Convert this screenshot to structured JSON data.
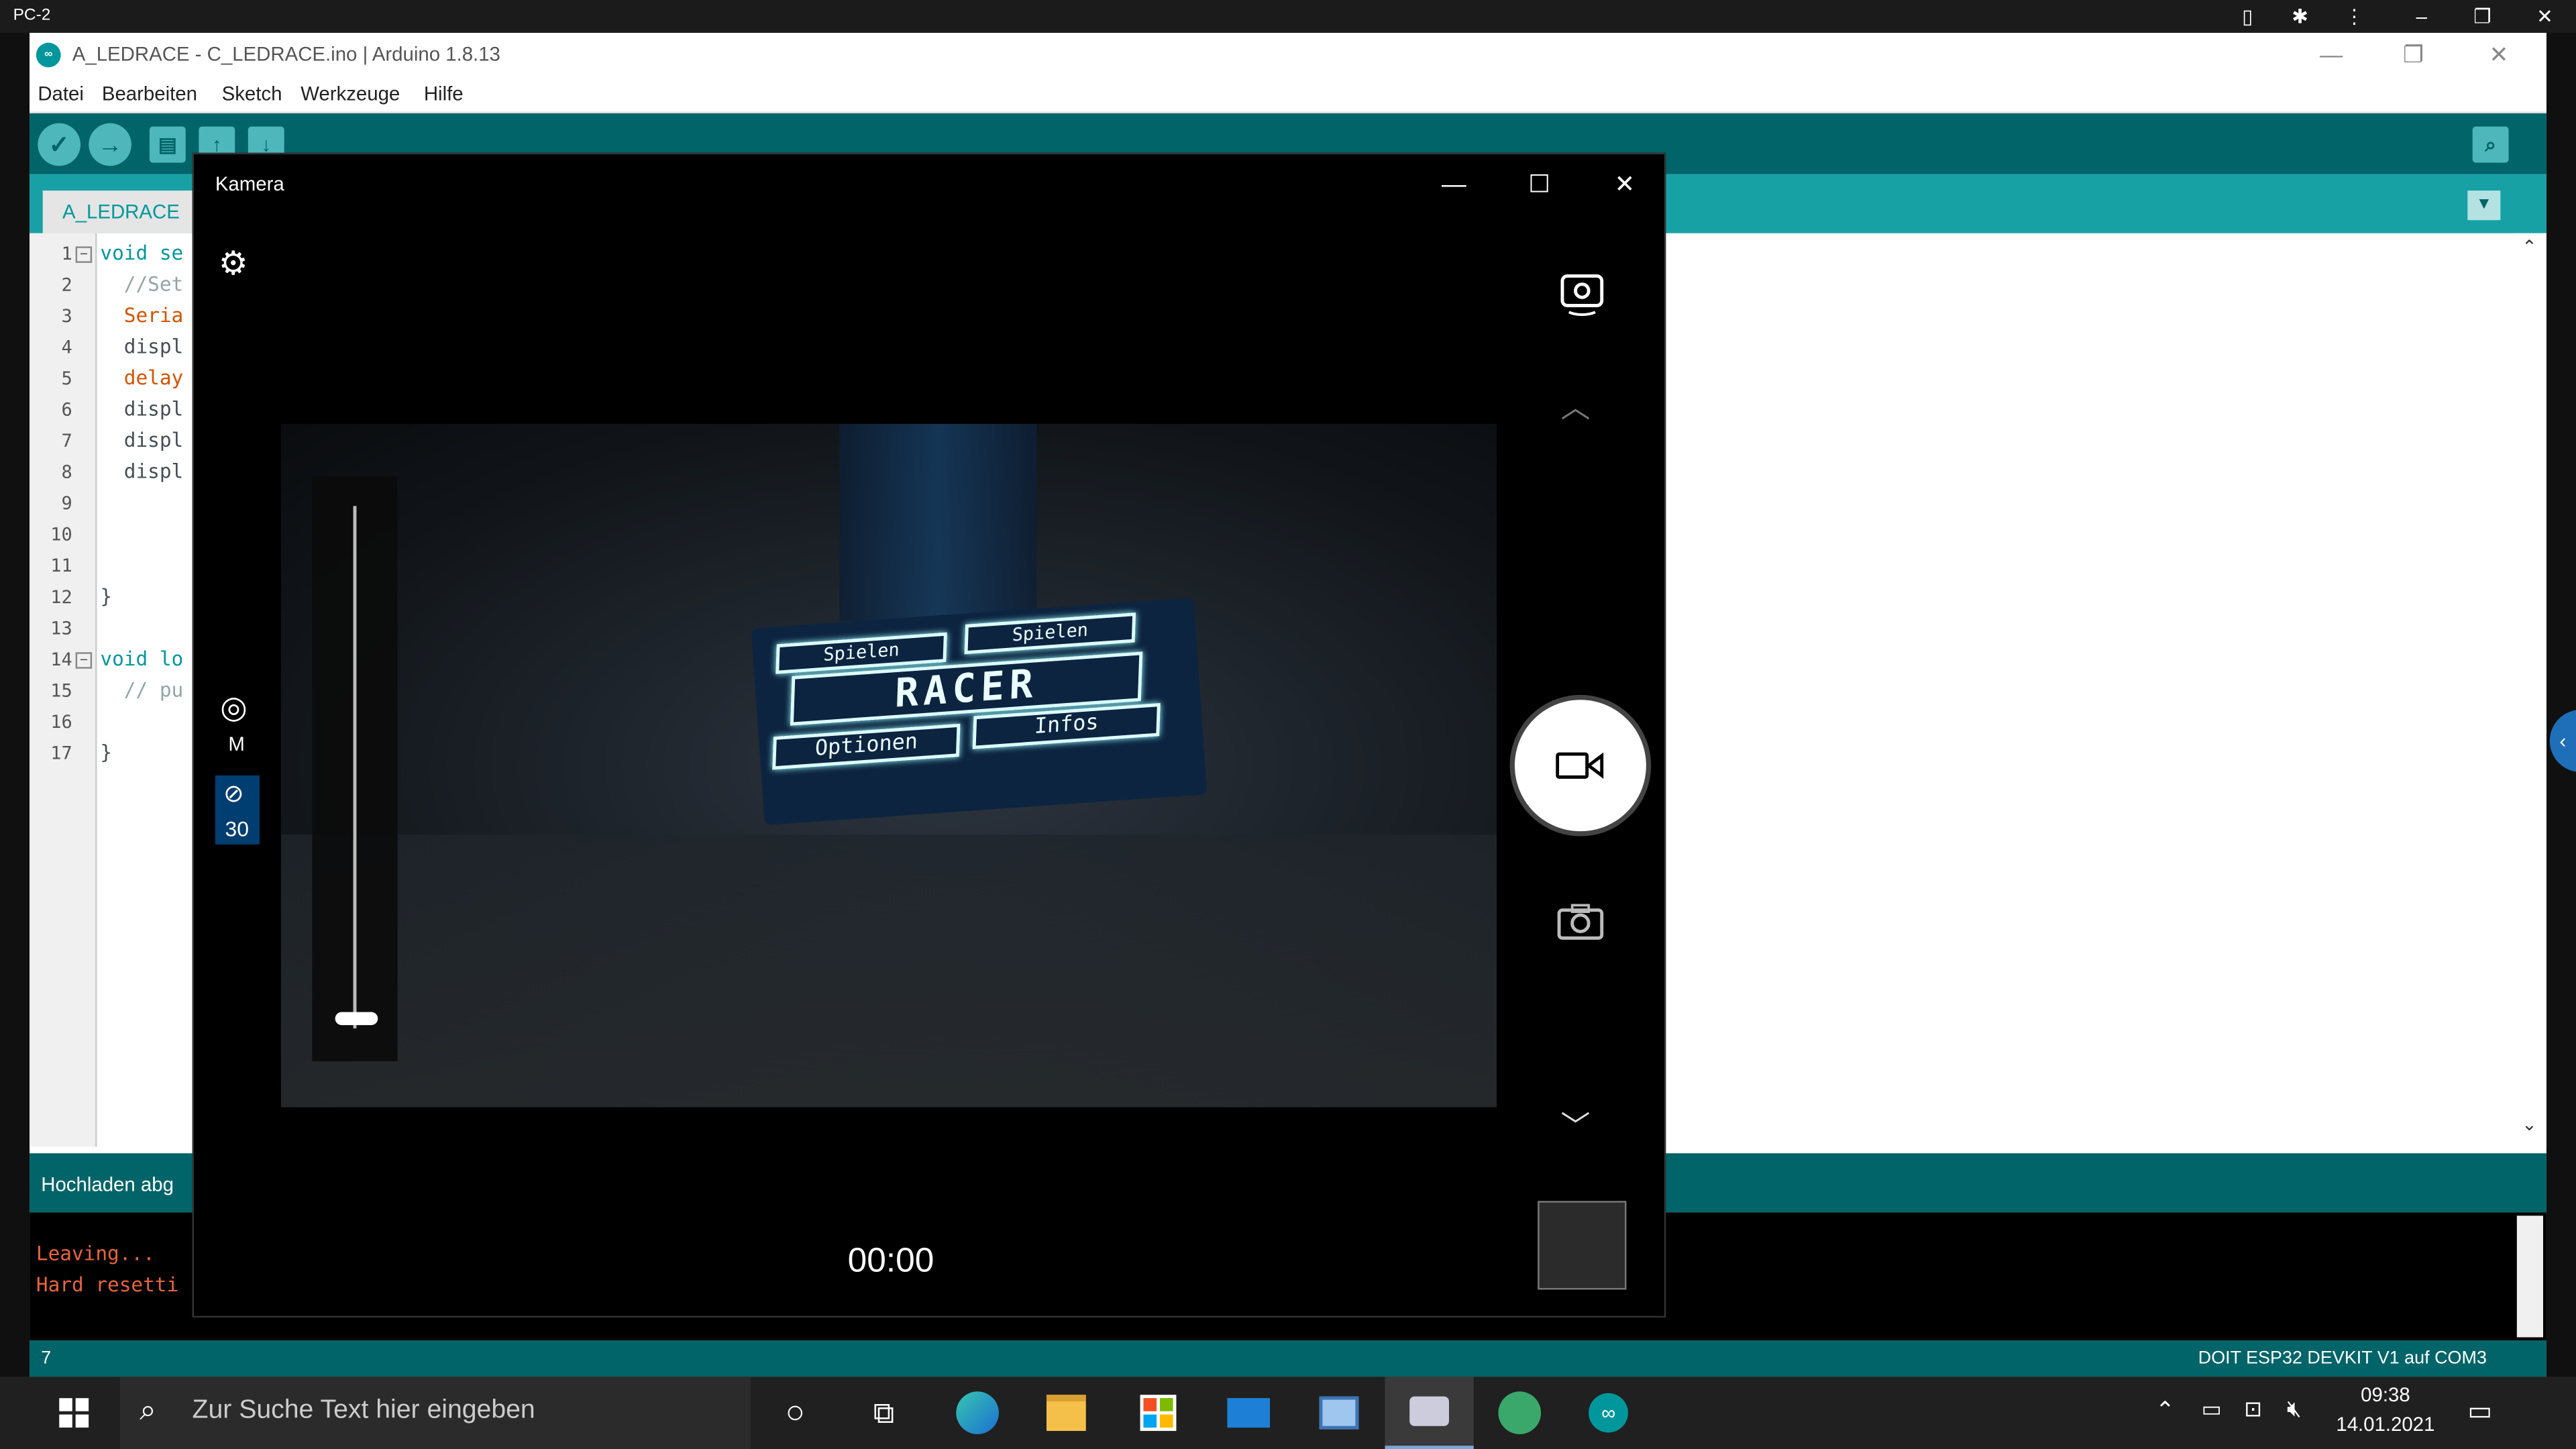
{
  "remote_bar": {
    "title": "PC-2"
  },
  "arduino": {
    "window_title": "A_LEDRACE - C_LEDRACE.ino | Arduino 1.8.13",
    "menu": [
      "Datei",
      "Bearbeiten",
      "Sketch",
      "Werkzeuge",
      "Hilfe"
    ],
    "tab_label": "A_LEDRACE",
    "code_lines": [
      {
        "n": "1",
        "text": "void se",
        "fold": true
      },
      {
        "n": "2",
        "text": "  //Set"
      },
      {
        "n": "3",
        "text": "  Seria"
      },
      {
        "n": "4",
        "text": "  displ"
      },
      {
        "n": "5",
        "text": "  delay"
      },
      {
        "n": "6",
        "text": "  displ"
      },
      {
        "n": "7",
        "text": "  displ"
      },
      {
        "n": "8",
        "text": "  displ"
      },
      {
        "n": "9",
        "text": ""
      },
      {
        "n": "10",
        "text": ""
      },
      {
        "n": "11",
        "text": ""
      },
      {
        "n": "12",
        "text": "}"
      },
      {
        "n": "13",
        "text": ""
      },
      {
        "n": "14",
        "text": "void lo",
        "fold": true
      },
      {
        "n": "15",
        "text": "  // pu"
      },
      {
        "n": "16",
        "text": ""
      },
      {
        "n": "17",
        "text": "}"
      }
    ],
    "status_text": "Hochladen abg",
    "console_lines": [
      "Leaving...",
      "Hard resetti"
    ],
    "footer_line": "7",
    "footer_board": "DOIT ESP32 DEVKIT V1 auf COM3",
    "colors": {
      "teal_dark": "#006468",
      "teal_light": "#17a1a5",
      "console_text": "#e8643b"
    }
  },
  "camera": {
    "title": "Kamera",
    "mode_label": "M",
    "timer_value": "30",
    "elapsed": "00:00",
    "zoom_level": 0.0,
    "oled_text": {
      "spielen1": "Spielen",
      "spielen2": "Spielen",
      "racer": "RACER",
      "optionen": "Optionen",
      "infos": "Infos"
    }
  },
  "taskbar": {
    "search_placeholder": "Zur Suche Text hier eingeben",
    "time": "09:38",
    "date": "14.01.2021"
  }
}
